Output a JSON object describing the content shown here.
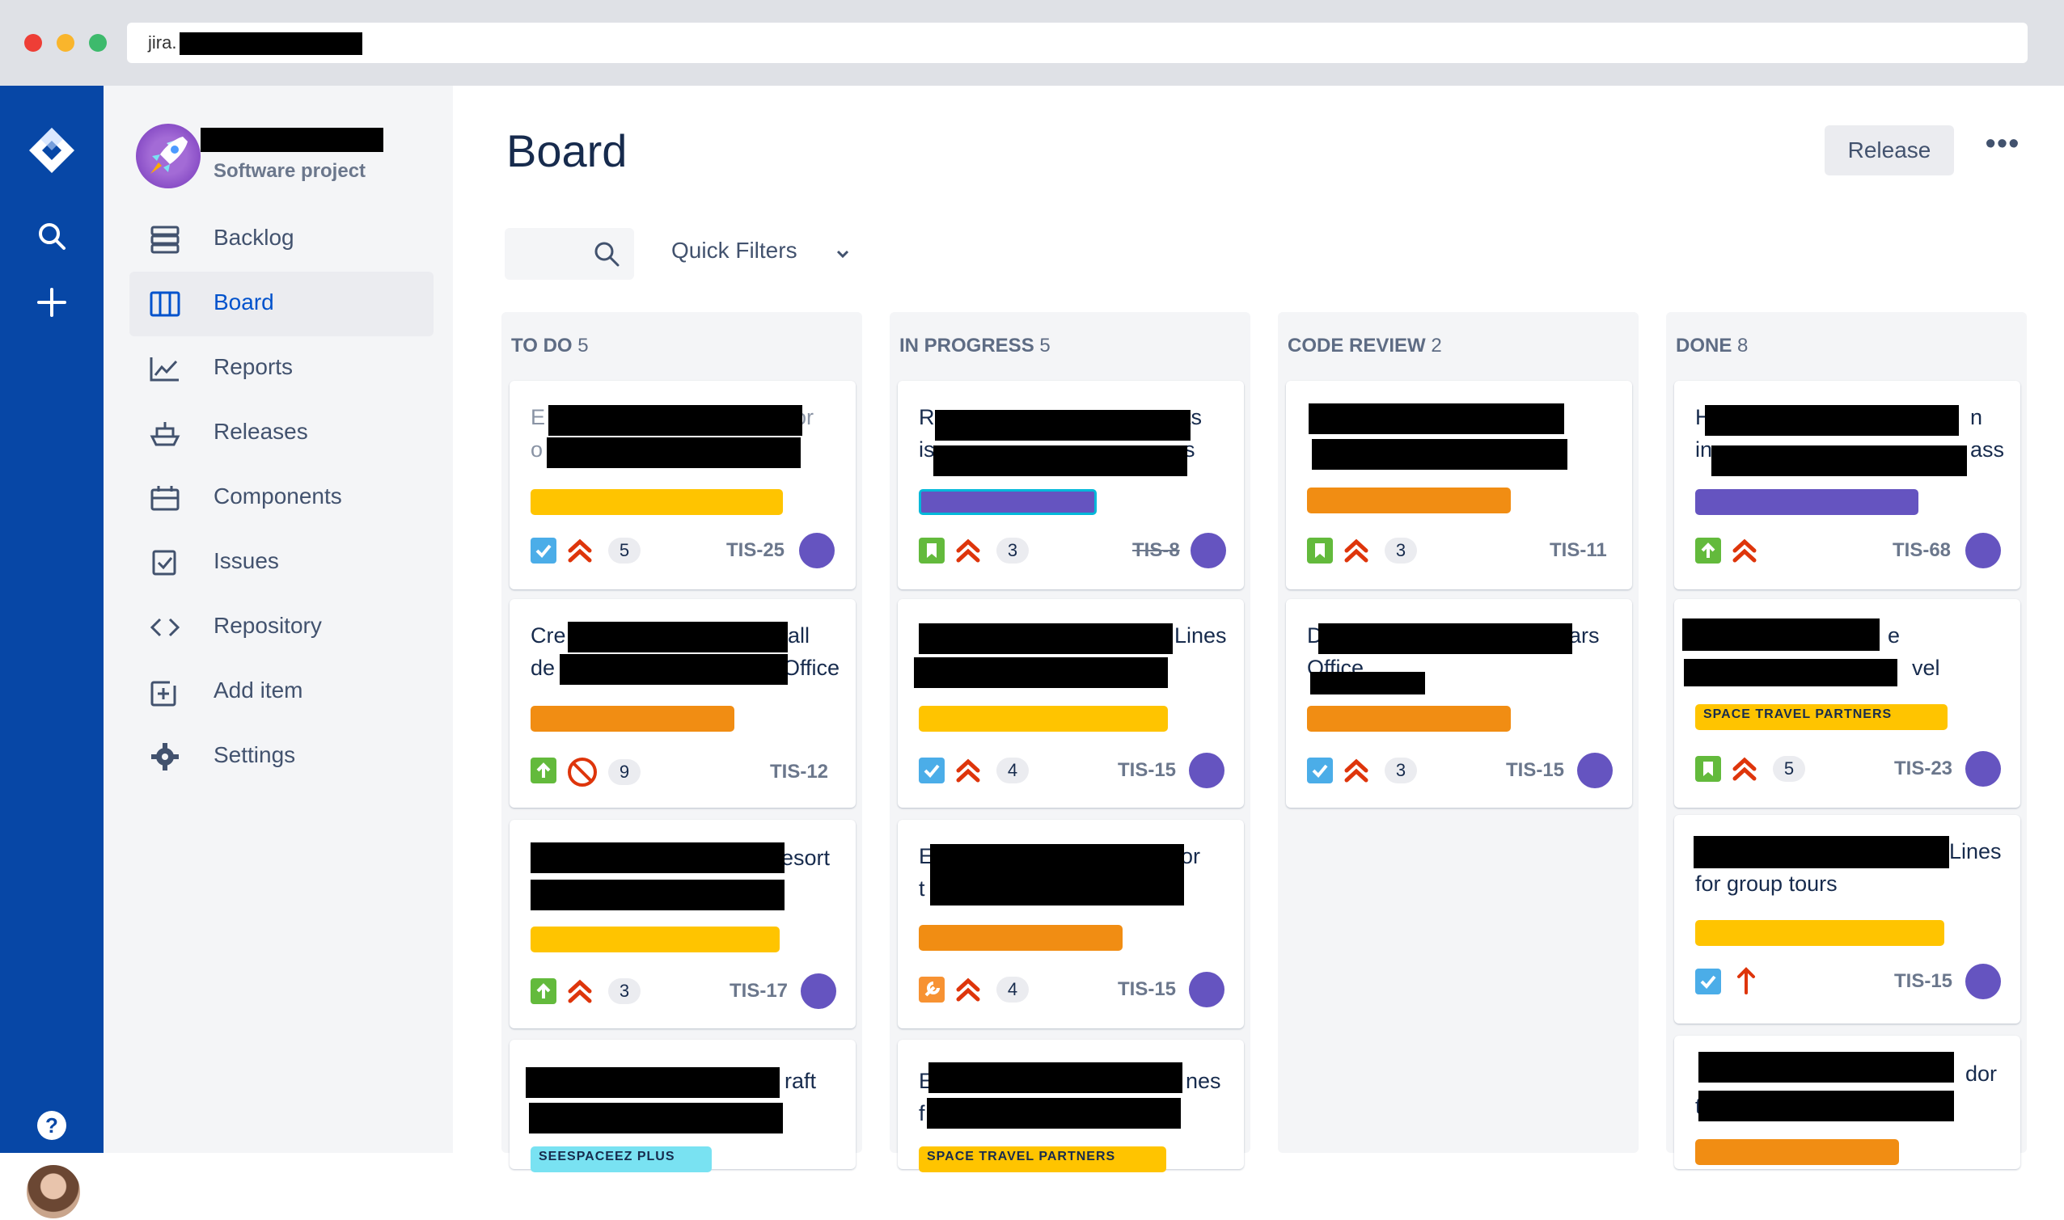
{
  "browser": {
    "url": "jira."
  },
  "project": {
    "type": "Software project"
  },
  "nav": [
    {
      "label": "Backlog"
    },
    {
      "label": "Board"
    },
    {
      "label": "Reports"
    },
    {
      "label": "Releases"
    },
    {
      "label": "Components"
    },
    {
      "label": "Issues"
    },
    {
      "label": "Repository"
    },
    {
      "label": "Add item"
    },
    {
      "label": "Settings"
    }
  ],
  "global_nav": {
    "help": "?"
  },
  "page": {
    "title": "Board",
    "release_button": "Release",
    "more_button": "•••"
  },
  "filters": {
    "quick_filters": "Quick Filters"
  },
  "columns": [
    {
      "name": "TO DO",
      "count": "5"
    },
    {
      "name": "IN PROGRESS",
      "count": "5"
    },
    {
      "name": "CODE REVIEW",
      "count": "2"
    },
    {
      "name": "DONE",
      "count": "8"
    }
  ],
  "colors": {
    "blue_nav": "#0747a6",
    "yellow": "#ffc400",
    "orange": "#f18d13",
    "purple": "#6554c0",
    "cyan": "#79e2f2"
  },
  "cards": {
    "todo": [
      {
        "line1_start": "E",
        "line1_end": "or",
        "line2_start": "o",
        "count": "5",
        "key": "TIS-25",
        "type": "task-icon",
        "priority": "highest"
      },
      {
        "line1_start": "Cre",
        "line1_end": "all",
        "line2_start": "de",
        "line2_end": "Office",
        "count": "9",
        "key": "TIS-12",
        "type": "story-up-icon",
        "priority": "blocker"
      },
      {
        "line1_end": "esort",
        "count": "3",
        "key": "TIS-17",
        "type": "story-up-icon",
        "priority": "highest"
      },
      {
        "line1_end": "raft",
        "label": "SEESPACEEZ PLUS"
      }
    ],
    "inprogress": [
      {
        "line1_start": "R",
        "line1_end": "nts",
        "line2_start": "is",
        "line2_end": "s",
        "count": "3",
        "key": "TIS-8",
        "type": "story-icon",
        "priority": "highest"
      },
      {
        "line1_end": "Lines",
        "count": "4",
        "key": "TIS-15",
        "type": "task-icon",
        "priority": "highest"
      },
      {
        "line1_start": "E",
        "line1_end": "or",
        "line2_start": "t",
        "count": "4",
        "key": "TIS-15",
        "type": "bug-icon",
        "priority": "highest"
      },
      {
        "line1_start": "E",
        "line1_end": "nes",
        "line2_start": "f",
        "label": "SPACE TRAVEL PARTNERS"
      }
    ],
    "review": [
      {
        "count": "3",
        "key": "TIS-11",
        "type": "story-icon",
        "priority": "highest"
      },
      {
        "line1_start": "D",
        "line1_end": "ars",
        "line2_start": "Office",
        "count": "3",
        "key": "TIS-15",
        "type": "task-icon",
        "priority": "highest"
      }
    ],
    "done": [
      {
        "line1_start": "H",
        "line1_end": "n",
        "line2_start": "in",
        "line2_end": "ass",
        "key": "TIS-68",
        "type": "story-up-icon",
        "priority": "highest"
      },
      {
        "line1_end": "e",
        "line2_end": "vel",
        "label": "SPACE TRAVEL PARTNERS",
        "count": "5",
        "key": "TIS-23",
        "type": "story-icon",
        "priority": "highest"
      },
      {
        "line1_end": "Lines",
        "line2": "for group tours",
        "key": "TIS-15",
        "type": "task-icon",
        "priority": "high"
      },
      {
        "line1_end": "dor",
        "line2_start": "t"
      }
    ]
  }
}
